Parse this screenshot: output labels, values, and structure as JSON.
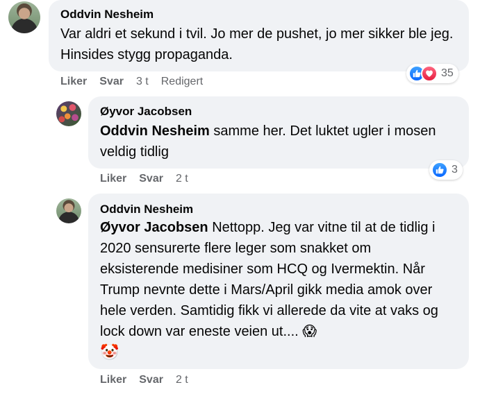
{
  "comments": [
    {
      "author": "Oddvin Nesheim",
      "text": "Var aldri et sekund i tvil. Jo mer de pushet, jo mer sikker ble jeg. Hinsides stygg propaganda.",
      "like_label": "Liker",
      "reply_label": "Svar",
      "time": "3 t",
      "edited": "Redigert",
      "reaction_count": "35"
    },
    {
      "author": "Øyvor Jacobsen",
      "mention": "Oddvin Nesheim",
      "text": "samme her. Det luktet ugler i mosen veldig tidlig",
      "like_label": "Liker",
      "reply_label": "Svar",
      "time": "2 t",
      "reaction_count": "3"
    },
    {
      "author": "Oddvin Nesheim",
      "mention": "Øyvor Jacobsen",
      "text": "Nettopp. Jeg var vitne til at de tidlig i 2020 sensurerte flere leger som snakket om eksisterende medisiner som HCQ og Ivermektin. Når Trump nevnte dette i Mars/April gikk media amok over hele verden. Samtidig fikk vi allerede da vite at vaks og lock down var eneste veien ut.... 😱",
      "emoji_line": "🤡",
      "like_label": "Liker",
      "reply_label": "Svar",
      "time": "2 t"
    }
  ],
  "colors": {
    "bubble": "#f0f2f5",
    "meta": "#65676b",
    "like": "#0866ff",
    "love": "#e61e3f"
  },
  "icons": [
    "like-icon",
    "love-icon",
    "avatar"
  ]
}
